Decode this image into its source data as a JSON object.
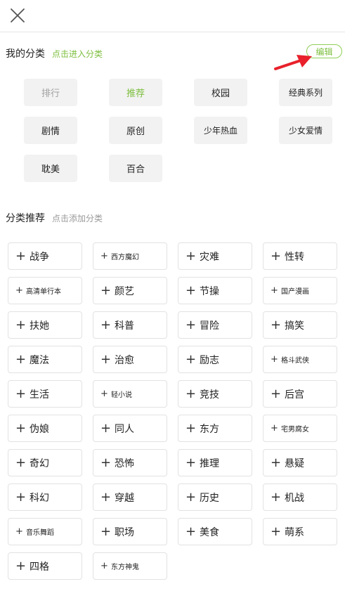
{
  "header": {
    "close_icon": "close-icon"
  },
  "my_categories": {
    "title": "我的分类",
    "hint": "点击进入分类",
    "edit_label": "编辑",
    "items": [
      {
        "label": "排行",
        "state": "disabled"
      },
      {
        "label": "推荐",
        "state": "active"
      },
      {
        "label": "校园",
        "state": "normal"
      },
      {
        "label": "经典系列",
        "state": "normal"
      },
      {
        "label": "剧情",
        "state": "normal"
      },
      {
        "label": "原创",
        "state": "normal"
      },
      {
        "label": "少年热血",
        "state": "normal"
      },
      {
        "label": "少女爱情",
        "state": "normal"
      },
      {
        "label": "耽美",
        "state": "normal"
      },
      {
        "label": "百合",
        "state": "normal"
      }
    ]
  },
  "recommended": {
    "title": "分类推荐",
    "hint": "点击添加分类",
    "plus_icon": "plus-icon",
    "items": [
      {
        "label": "战争"
      },
      {
        "label": "西方魔幻",
        "small": true
      },
      {
        "label": "灾难"
      },
      {
        "label": "性转"
      },
      {
        "label": "高清单行本",
        "small": true
      },
      {
        "label": "颜艺"
      },
      {
        "label": "节操"
      },
      {
        "label": "国产漫画",
        "small": true
      },
      {
        "label": "扶她"
      },
      {
        "label": "科普"
      },
      {
        "label": "冒险"
      },
      {
        "label": "搞笑"
      },
      {
        "label": "魔法"
      },
      {
        "label": "治愈"
      },
      {
        "label": "励志"
      },
      {
        "label": "格斗武侠",
        "small": true
      },
      {
        "label": "生活"
      },
      {
        "label": "轻小说",
        "small": true
      },
      {
        "label": "竞技"
      },
      {
        "label": "后宫"
      },
      {
        "label": "伪娘"
      },
      {
        "label": "同人"
      },
      {
        "label": "东方"
      },
      {
        "label": "宅男腐女",
        "small": true
      },
      {
        "label": "奇幻"
      },
      {
        "label": "恐怖"
      },
      {
        "label": "推理"
      },
      {
        "label": "悬疑"
      },
      {
        "label": "科幻"
      },
      {
        "label": "穿越"
      },
      {
        "label": "历史"
      },
      {
        "label": "机战"
      },
      {
        "label": "音乐舞蹈",
        "small": true
      },
      {
        "label": "职场"
      },
      {
        "label": "美食"
      },
      {
        "label": "萌系"
      },
      {
        "label": "四格"
      },
      {
        "label": "东方神鬼",
        "small": true
      }
    ]
  },
  "colors": {
    "accent_green": "#7dbf3e",
    "annotation_red": "#e8212b"
  }
}
